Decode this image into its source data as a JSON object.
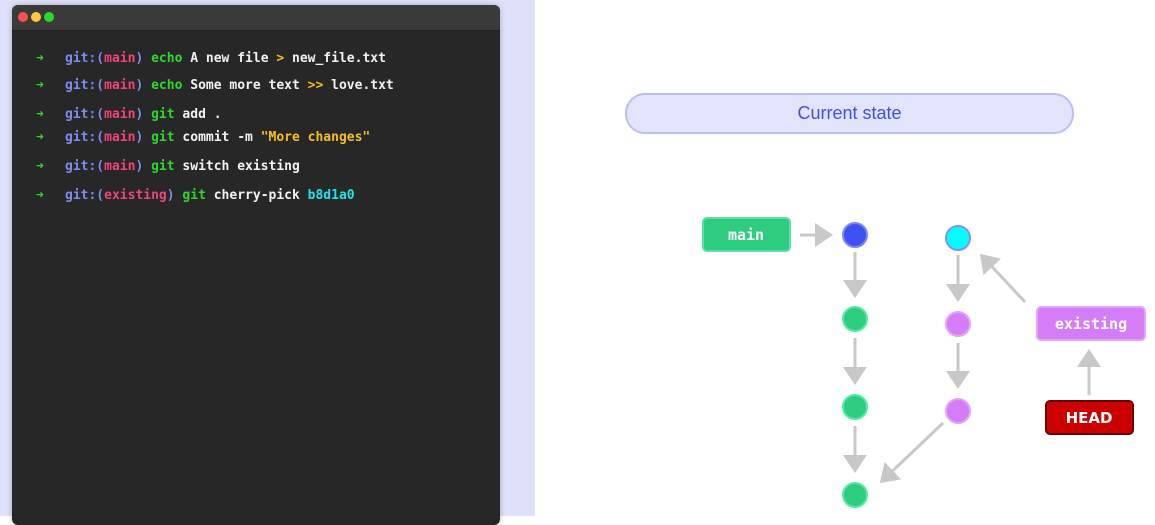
{
  "terminal": {
    "lines": [
      {
        "prompt": "git:(",
        "branch": "main",
        "close": ")",
        "cmd": "echo",
        "rest": " A new file ",
        "op": ">",
        "tail": " new_file.txt"
      },
      {
        "prompt": "git:(",
        "branch": "main",
        "close": ")",
        "cmd": "echo",
        "rest": " Some more text ",
        "op": ">>",
        "tail": " love.txt"
      },
      {
        "prompt": "git:(",
        "branch": "main",
        "close": ")",
        "cmd": "git",
        "rest": " add .",
        "op": "",
        "tail": ""
      },
      {
        "prompt": "git:(",
        "branch": "main",
        "close": ")",
        "cmd": "git",
        "rest": " commit -m ",
        "op": "\"More changes\"",
        "tail": ""
      },
      {
        "prompt": "git:(",
        "branch": "main",
        "close": ")",
        "cmd": "git",
        "rest": " switch existing",
        "op": "",
        "tail": ""
      },
      {
        "prompt": "git:(",
        "branch": "existing",
        "close": ")",
        "cmd": "git",
        "rest": " cherry-pick ",
        "op": "",
        "tail": "",
        "hash": "b8d1a0"
      }
    ],
    "arrow": "➜"
  },
  "diagram": {
    "title": "Current state",
    "labels": {
      "main": "main",
      "existing": "existing",
      "head": "HEAD"
    },
    "colors": {
      "main": "#2ecc7f",
      "existing": "#d57cf8",
      "head": "#cc0000",
      "main_head_commit": "#3f51f0",
      "cherry_picked_commit": "#00ffff"
    }
  }
}
